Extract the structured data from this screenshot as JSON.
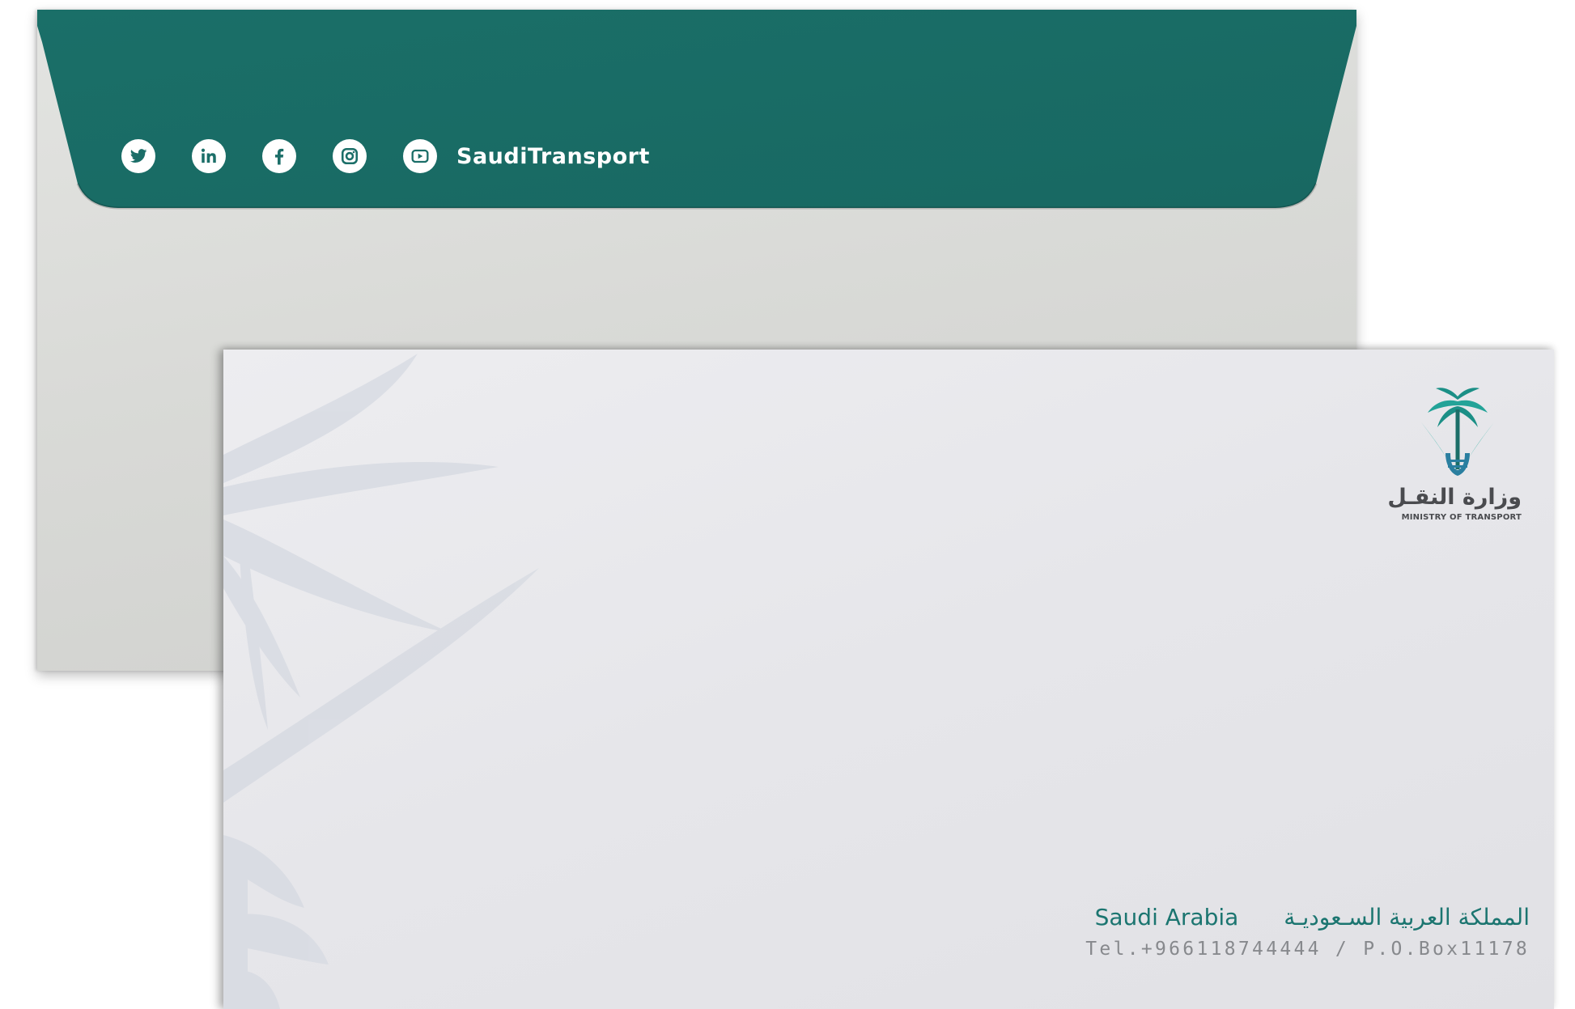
{
  "colors": {
    "flap_teal": "#1b6e68",
    "accent_teal": "#1b7570",
    "logo_gray": "#4a4b4f",
    "contact_gray": "#87898d",
    "paper_back": "#dcdcd9",
    "paper_front": "#e7e7eb"
  },
  "back_envelope": {
    "social_icons": [
      {
        "icon": "twitter-icon"
      },
      {
        "icon": "linkedin-icon"
      },
      {
        "icon": "facebook-icon"
      },
      {
        "icon": "instagram-icon"
      },
      {
        "icon": "youtube-icon"
      }
    ],
    "social_handle": "SaudiTransport"
  },
  "front_envelope": {
    "logo": {
      "arabic": "وزارة النقـل",
      "english": "MINISTRY OF TRANSPORT"
    },
    "address": {
      "country_en": "Saudi Arabia",
      "country_ar": "المملكة العربية السـعوديـة",
      "contact": "Tel.+966118744444 / P.O.Box11178"
    }
  }
}
